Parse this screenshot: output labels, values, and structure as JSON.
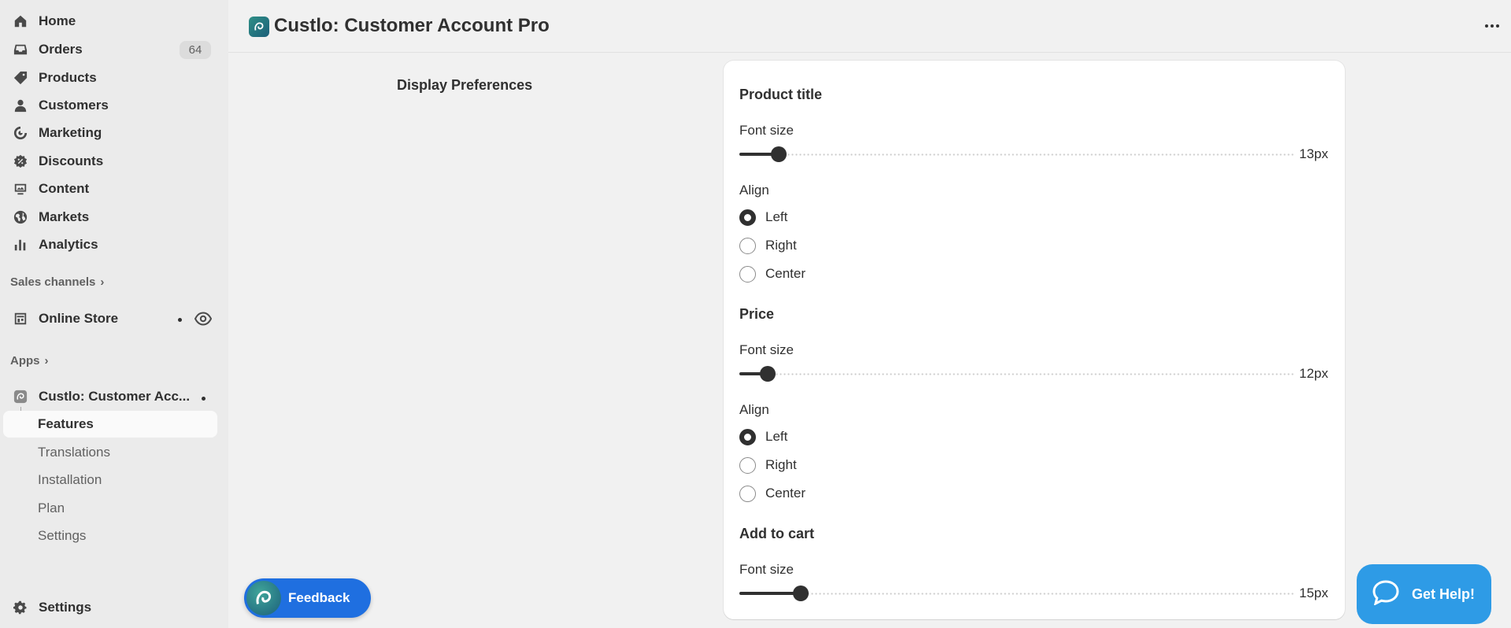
{
  "sidebar": {
    "nav": [
      {
        "label": "Home",
        "icon": "home-icon"
      },
      {
        "label": "Orders",
        "icon": "inbox-icon",
        "badge": "64"
      },
      {
        "label": "Products",
        "icon": "tag-icon"
      },
      {
        "label": "Customers",
        "icon": "person-icon"
      },
      {
        "label": "Marketing",
        "icon": "target-icon"
      },
      {
        "label": "Discounts",
        "icon": "discount-icon"
      },
      {
        "label": "Content",
        "icon": "content-icon"
      },
      {
        "label": "Markets",
        "icon": "globe-icon"
      },
      {
        "label": "Analytics",
        "icon": "bar-chart-icon"
      }
    ],
    "sales_channels_label": "Sales channels",
    "online_store_label": "Online Store",
    "apps_label": "Apps",
    "app_name": "Custlo: Customer Acc...",
    "app_subitems": [
      "Features",
      "Translations",
      "Installation",
      "Plan",
      "Settings"
    ],
    "settings_label": "Settings"
  },
  "header": {
    "title": "Custlo: Customer Account Pro"
  },
  "main": {
    "section_title": "Display Preferences",
    "groups": [
      {
        "title": "Product title",
        "font_size_label": "Font size",
        "font_size_value": "13px",
        "slider_fraction": 0.071,
        "align_label": "Align",
        "options": [
          "Left",
          "Right",
          "Center"
        ],
        "selected": "Left"
      },
      {
        "title": "Price",
        "font_size_label": "Font size",
        "font_size_value": "12px",
        "slider_fraction": 0.051,
        "align_label": "Align",
        "options": [
          "Left",
          "Right",
          "Center"
        ],
        "selected": "Left"
      },
      {
        "title": "Add to cart",
        "font_size_label": "Font size",
        "font_size_value": "15px",
        "slider_fraction": 0.111
      }
    ]
  },
  "floating": {
    "feedback_label": "Feedback",
    "help_label": "Get Help!"
  },
  "colors": {
    "accent_dark": "#303030",
    "feedback_blue": "#1f6fe0",
    "help_blue": "#2e9be6"
  }
}
